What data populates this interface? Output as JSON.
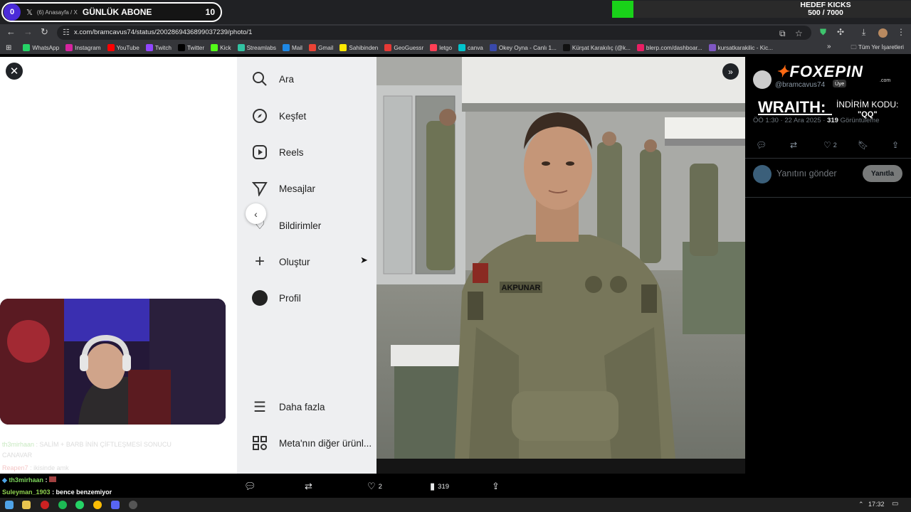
{
  "stream_overlay": {
    "daily_subs_label": "GÜNLÜK ABONE",
    "daily_subs_left": "0",
    "daily_subs_value": "10",
    "goal_title": "HEDEF KICKS",
    "goal_progress": "500 / 7000",
    "goal_fraction": 0.0714
  },
  "browser": {
    "tab_title": "(6) Anasayfa / X",
    "url": "x.com/bramcavus74/status/2002869436899037239/photo/1",
    "bookmarks": [
      {
        "label": "WhatsApp",
        "icon": "whatsapp-icon",
        "color": "#25d366"
      },
      {
        "label": "Instagram",
        "icon": "instagram-icon",
        "color": "#d6249f"
      },
      {
        "label": "YouTube",
        "icon": "youtube-icon",
        "color": "#ff0000"
      },
      {
        "label": "Twitch",
        "icon": "twitch-icon",
        "color": "#9146ff"
      },
      {
        "label": "Twitter",
        "icon": "x-icon",
        "color": "#000000"
      },
      {
        "label": "Kick",
        "icon": "kick-icon",
        "color": "#53fc18"
      },
      {
        "label": "Streamlabs",
        "icon": "streamlabs-icon",
        "color": "#31c3a2"
      },
      {
        "label": "Mail",
        "icon": "mail-icon",
        "color": "#1e88e5"
      },
      {
        "label": "Gmail",
        "icon": "gmail-icon",
        "color": "#ea4335"
      },
      {
        "label": "Sahibinden",
        "icon": "sahibinden-icon",
        "color": "#ffe800"
      },
      {
        "label": "GeoGuessr",
        "icon": "map-pin-icon",
        "color": "#e53935"
      },
      {
        "label": "letgo",
        "icon": "letgo-icon",
        "color": "#ff3f55"
      },
      {
        "label": "canva",
        "icon": "canva-icon",
        "color": "#00c4cc"
      },
      {
        "label": "Okey Oyna - Canlı 1...",
        "icon": "okey-icon",
        "color": "#3949ab"
      },
      {
        "label": "Kürşat Karakılıç (@k...",
        "icon": "tiktok-icon",
        "color": "#111111"
      },
      {
        "label": "blerp.com/dashboar...",
        "icon": "blerp-icon",
        "color": "#e91e63"
      },
      {
        "label": "kursatkarakilic - Kic...",
        "icon": "link-icon",
        "color": "#7e57c2"
      }
    ],
    "all_bookmarks_label": "Tüm Yer İşaretleri"
  },
  "sidebar": {
    "items": [
      {
        "label": "Ara",
        "icon": "search-icon"
      },
      {
        "label": "Keşfet",
        "icon": "compass-icon"
      },
      {
        "label": "Reels",
        "icon": "reels-icon"
      },
      {
        "label": "Mesajlar",
        "icon": "send-icon"
      },
      {
        "label": "Bildirimler",
        "icon": "heart-icon"
      },
      {
        "label": "Oluştur",
        "icon": "plus-icon"
      },
      {
        "label": "Profil",
        "icon": "profile-icon"
      },
      {
        "label": "Daha fazla",
        "icon": "menu-icon"
      },
      {
        "label": "Meta'nın diğer ürünl...",
        "icon": "grid-icon"
      }
    ]
  },
  "photo": {
    "name_tape": "AKPUNAR"
  },
  "tweet": {
    "handle": "@bramcavus74",
    "member_badge": "Üye",
    "sponsor_logo": "FOXEPIN",
    "sponsor_logo_sub": ".com",
    "sponsor_name": "WRAITH:",
    "discount_label": "İNDİRİM KODU:",
    "discount_code": "\"QQ\"",
    "time": "ÖÖ 1:30",
    "date": "22 Ara 2025",
    "views_count": "319",
    "views_label": "Görüntüleme",
    "like_count": "2",
    "reply_placeholder": "Yanıtını gönder",
    "reply_button": "Yanıtla"
  },
  "bottom_bar": {
    "like_count": "2",
    "views_count": "319"
  },
  "chat": {
    "lines": [
      {
        "user": "th3mirhaan",
        "text": ": SALİM + BARB İNİN ÇİFTLEŞMESİ SONUCU",
        "faded": true
      },
      {
        "user": "",
        "text": "CANAVAR",
        "faded": true
      },
      {
        "user": "Reapen7",
        "text": ": ikisinde amk",
        "faded": true
      },
      {
        "user": "th3mirhaan",
        "text": ":",
        "faded": false
      },
      {
        "user": "Suleyman_1903",
        "text": ": bence benzemiyor",
        "faded": false
      }
    ]
  },
  "taskbar": {
    "clock": "17:32"
  }
}
